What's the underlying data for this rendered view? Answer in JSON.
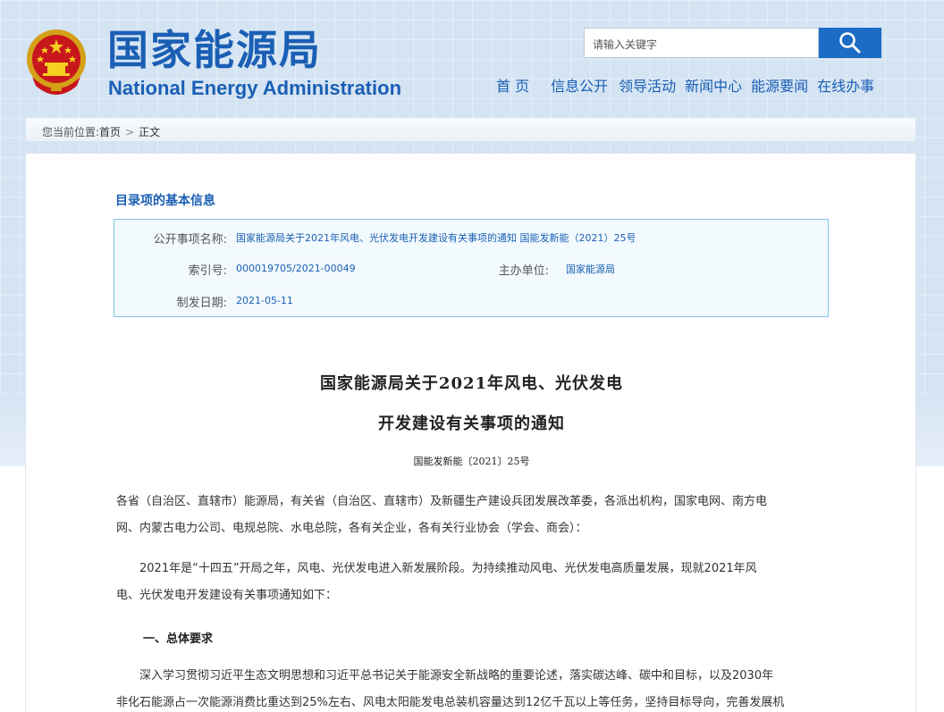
{
  "header": {
    "logo_cn": "国家能源局",
    "logo_en": "National Energy Administration",
    "search_placeholder": "请输入关键字",
    "nav": [
      "首 页",
      "信息公开",
      "领导活动",
      "新闻中心",
      "能源要闻",
      "在线办事"
    ]
  },
  "breadcrumb": {
    "prefix": "您当前位置:",
    "home": "首页",
    "separator": ">",
    "current": "正文"
  },
  "info": {
    "title": "目录项的基本信息",
    "name_label": "公开事项名称:",
    "name_value": "国家能源局关于2021年风电、光伏发电开发建设有关事项的通知 国能发新能（2021）25号",
    "index_label": "索引号:",
    "index_value": "000019705/2021-00049",
    "org_label": "主办单位:",
    "org_value": "国家能源局",
    "date_label": "制发日期:",
    "date_value": "2021-05-11"
  },
  "doc": {
    "title_line1": "国家能源局关于2021年风电、光伏发电",
    "title_line2": "开发建设有关事项的通知",
    "number": "国能发新能〔2021〕25号",
    "addressee_line1": "各省（自治区、直辖市）能源局，有关省（自治区、直辖市）及新疆生产建设兵团发展改革委，各派出机构，国家电网、南方电",
    "addressee_line2": "网、内蒙古电力公司、电规总院、水电总院，各有关企业，各有关行业协会（学会、商会）：",
    "intro_line1": "　　2021年是“十四五”开局之年，风电、光伏发电进入新发展阶段。为持续推动风电、光伏发电高质量发展，现就2021年风",
    "intro_line2": "电、光伏发电开发建设有关事项通知如下：",
    "section1": "一、总体要求",
    "body_line1": "　　深入学习贯彻习近平生态文明思想和习近平总书记关于能源安全新战略的重要论述，落实碳达峰、碳中和目标，以及2030年",
    "body_line2": "非化石能源占一次能源消费比重达到25%左右、风电太阳能发电总装机容量达到12亿千瓦以上等任务，坚持目标导向，完善发展机"
  },
  "colors": {
    "brand_blue": "#1a5fb4",
    "header_bg": "#d5e4f3",
    "info_box_bg": "#f2fafd",
    "info_box_border": "#7fc7e4"
  }
}
